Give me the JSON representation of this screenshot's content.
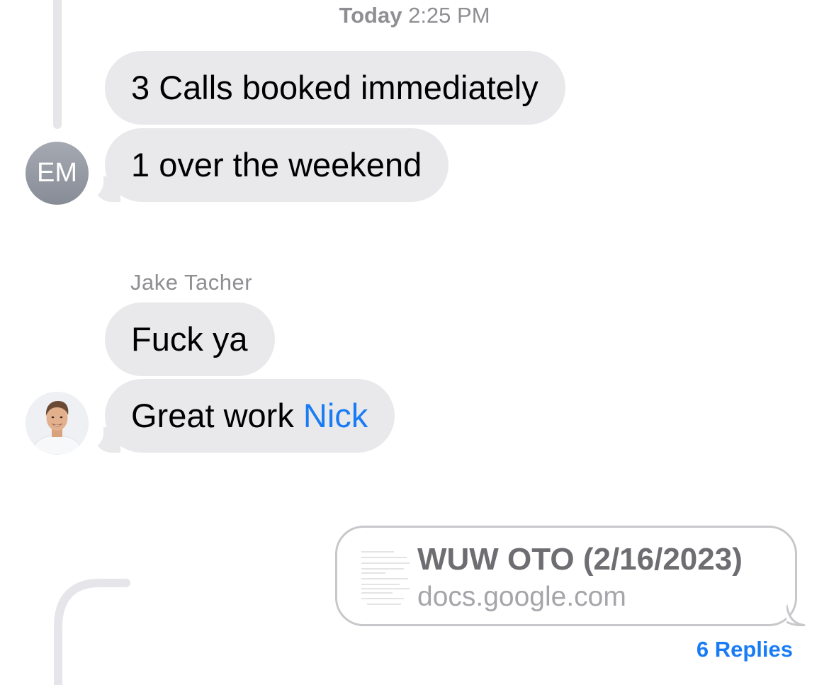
{
  "timestamp": {
    "day": "Today",
    "time": "2:25 PM"
  },
  "messages_group_1": {
    "avatar_initials": "EM",
    "bubbles": [
      {
        "text": "3 Calls booked immediately"
      },
      {
        "text": "1 over the weekend"
      }
    ]
  },
  "messages_group_2": {
    "sender": "Jake Tacher",
    "bubbles": [
      {
        "text": "Fuck ya"
      },
      {
        "text_prefix": "Great work ",
        "mention": "Nick"
      }
    ]
  },
  "link_preview": {
    "title": "WUW OTO (2/16/2023)",
    "domain": "docs.google.com",
    "thumbnail_icon": "document-icon"
  },
  "thread": {
    "replies_label": "6 Replies"
  },
  "colors": {
    "bubble_gray": "#e9e9eb",
    "accent_blue": "#1a7cf5",
    "secondary_text": "#8e8e93"
  }
}
